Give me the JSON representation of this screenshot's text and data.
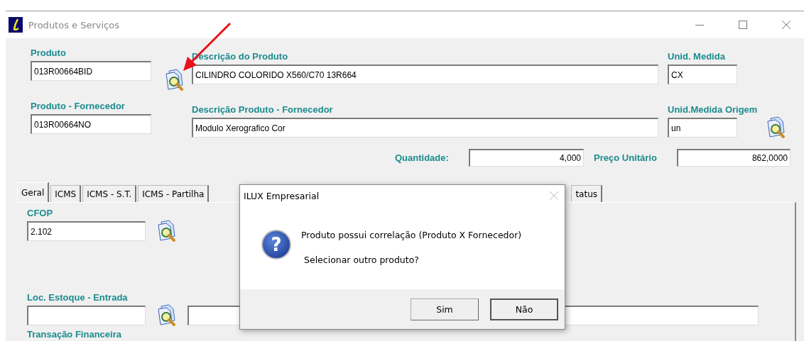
{
  "window": {
    "title": "Produtos e Serviços"
  },
  "product": {
    "label": "Produto",
    "value": "013R00664BID"
  },
  "description": {
    "label": "Descrição do Produto",
    "value": "CILINDRO COLORIDO X560/C70 13R664"
  },
  "unit": {
    "label": "Unid. Medida",
    "value": "CX"
  },
  "supplier_product": {
    "label": "Produto - Fornecedor",
    "value": "013R00664NO"
  },
  "supplier_description": {
    "label": "Descrição Produto - Fornecedor",
    "value": "Modulo Xerografico Cor"
  },
  "origin_unit": {
    "label": "Unid.Medida Origem",
    "value": "un"
  },
  "quantity": {
    "label": "Quantidade:",
    "value": "4,000"
  },
  "unit_price": {
    "label": "Preço Unitário",
    "value": "862,0000"
  },
  "tabs": [
    {
      "label": "Geral",
      "selected": true
    },
    {
      "label": "ICMS",
      "selected": false
    },
    {
      "label": "ICMS - S.T.",
      "selected": false
    },
    {
      "label": "ICMS - Partilha",
      "selected": false
    },
    {
      "label": "tatus",
      "selected": false
    }
  ],
  "cfop": {
    "label": "CFOP",
    "value": "2.102"
  },
  "stock_location": {
    "label": "Loc. Estoque - Entrada"
  },
  "transaction": {
    "label": "Transação Financeira"
  },
  "dialog": {
    "title": "ILUX Empresarial",
    "icon_glyph": "?",
    "lines": [
      "Produto possui correlação (Produto X Fornecedor)",
      "Selecionar outro produto?"
    ],
    "buttons": [
      {
        "label": "Sim",
        "default": false
      },
      {
        "label": "Não",
        "default": true
      }
    ]
  }
}
